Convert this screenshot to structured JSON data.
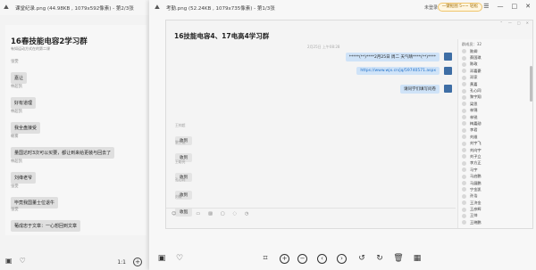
{
  "left_viewer": {
    "title": "课堂纪录.png (44.98KB , 1079x592像素) - 第2/3张",
    "chat": {
      "group_title": "16春技能电容2学习群",
      "subtitle": "有如运动方式在的第二课",
      "messages": [
        {
          "sender": "张雯",
          "text": "嘉让"
        },
        {
          "sender": "林超凯",
          "text": "好有道理"
        },
        {
          "sender": "林超凯",
          "text": "我全盘接受"
        },
        {
          "sender": "朝雾",
          "text": "量国达时3次可以买要，都让到来给更装与回去了"
        },
        {
          "sender": "林超凯",
          "text": "刘绛老爷"
        },
        {
          "sender": "张雯",
          "text": "毕竟我国董士位退牛"
        },
        {
          "sender": "张雯",
          "text": "葡成忠于文章：一心想回到文章"
        }
      ]
    },
    "page_indicator": "1:1"
  },
  "right_viewer": {
    "title": "考勤.png (52.24KB , 1079x735像素) - 第1/3张",
    "status": "未登录",
    "promo": "一键抠图 5~~ 轻松",
    "chat": {
      "group_title": "16技能电容4、17电高4学习群",
      "timestamp": "2月25日 上午08:28",
      "outgoing": [
        "*****(**)****2月25日 周二 天气晴****(**)****",
        "https://www.wjx.cn/jq/59740571.aspx",
        "请同学们填写问卷"
      ],
      "replies": [
        {
          "sender": "王帅超",
          "text": "收到"
        },
        {
          "sender": "黎宇翔",
          "text": "收到"
        },
        {
          "sender": "王聪亮",
          "text": "收到"
        },
        {
          "sender": "孔心同",
          "text": "收到"
        },
        {
          "sender": "刘敏",
          "text": "收到"
        }
      ],
      "input_icons": [
        "smile-icon",
        "scissors-icon",
        "folder-icon",
        "image-icon",
        "box-icon",
        "shake-icon",
        "clock-icon"
      ],
      "members_header": "群成员：32",
      "members": [
        "陈卿",
        "蔡国琪",
        "陈政",
        "邓嘉豪",
        "邓家",
        "黄嘉",
        "孔心同",
        "黎宇翔",
        "梁思",
        "林锦",
        "林锐",
        "梅嘉勋",
        "李君",
        "刘维",
        "刘宇飞",
        "刘向宇",
        "刘子立",
        "李方正",
        "马宇",
        "马启鹏",
        "马展鹏",
        "宁金凯",
        "孙浩",
        "王济金",
        "王彦辉",
        "王帅",
        "王晓鹏"
      ]
    }
  },
  "colors": {
    "outgoing_bubble": "#cfe3f8",
    "incoming_bubble": "#e4e4e4",
    "link": "#1f6fc7"
  }
}
